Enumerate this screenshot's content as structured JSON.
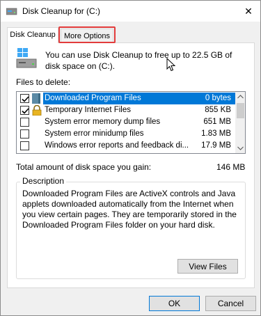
{
  "window": {
    "title": "Disk Cleanup for  (C:)",
    "close_glyph": "✕"
  },
  "tabs": [
    {
      "label": "Disk Cleanup",
      "active": true
    },
    {
      "label": "More Options",
      "active": false,
      "highlighted": true
    }
  ],
  "summary": {
    "text": "You can use Disk Cleanup to free up to 22.5 GB of disk space on  (C:)."
  },
  "files": {
    "label": "Files to delete:",
    "items": [
      {
        "name": "Downloaded Program Files",
        "size": "0 bytes",
        "checked": true,
        "selected": true,
        "icon": "folder-icon"
      },
      {
        "name": "Temporary Internet Files",
        "size": "855 KB",
        "checked": true,
        "selected": false,
        "icon": "lock-icon"
      },
      {
        "name": "System error memory dump files",
        "size": "651 MB",
        "checked": false,
        "selected": false,
        "icon": "none"
      },
      {
        "name": "System error minidump files",
        "size": "1.83 MB",
        "checked": false,
        "selected": false,
        "icon": "none"
      },
      {
        "name": "Windows error reports and feedback di...",
        "size": "17.9 MB",
        "checked": false,
        "selected": false,
        "icon": "none"
      }
    ]
  },
  "total": {
    "label": "Total amount of disk space you gain:",
    "value": "146 MB"
  },
  "description": {
    "legend": "Description",
    "text": "Downloaded Program Files are ActiveX controls and Java applets downloaded automatically from the Internet when you view certain pages. They are temporarily stored in the Downloaded Program Files folder on your hard disk."
  },
  "buttons": {
    "view_files": "View Files",
    "ok": "OK",
    "cancel": "Cancel"
  },
  "colors": {
    "selection": "#0078d7",
    "highlight_outline": "#e23b3b"
  }
}
